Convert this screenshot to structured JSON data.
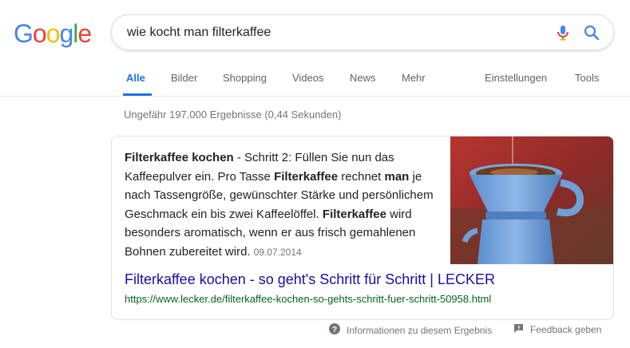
{
  "logo": {
    "letters": [
      "G",
      "o",
      "o",
      "g",
      "l",
      "e"
    ],
    "colors": [
      "#4285F4",
      "#EA4335",
      "#FBBC05",
      "#4285F4",
      "#34A853",
      "#EA4335"
    ]
  },
  "search": {
    "query": "wie kocht man filterkaffee"
  },
  "tabs": {
    "all": "Alle",
    "images": "Bilder",
    "shopping": "Shopping",
    "videos": "Videos",
    "news": "News",
    "more": "Mehr",
    "settings": "Einstellungen",
    "tools": "Tools"
  },
  "stats": "Ungefähr 197.000 Ergebnisse (0,44 Sekunden)",
  "featured": {
    "snippet_parts": [
      {
        "text": "Filterkaffee kochen",
        "bold": true
      },
      {
        "text": " - Schritt 2: Füllen Sie nun das Kaffeepulver ein. Pro Tasse ",
        "bold": false
      },
      {
        "text": "Filterkaffee",
        "bold": true
      },
      {
        "text": " rechnet ",
        "bold": false
      },
      {
        "text": "man",
        "bold": true
      },
      {
        "text": " je nach Tassengröße, gewünschter Stärke und persönlichem Geschmack ein bis zwei Kaffeelöffel. ",
        "bold": false
      },
      {
        "text": "Filterkaffee",
        "bold": true
      },
      {
        "text": " wird besonders aromatisch, wenn er aus frisch gemahlenen Bohnen zubereitet wird.",
        "bold": false
      }
    ],
    "date": "09.07.2014",
    "title_main": "Filterkaffee kochen",
    "title_sep": " - ",
    "title_rest": "so geht's Schritt für Schritt | LECKER",
    "url": "https://www.lecker.de/filterkaffee-kochen-so-gehts-schritt-fuer-schritt-50958.html",
    "image_icon": "coffee-filter-photo"
  },
  "footer": {
    "info": "Informationen zu diesem Ergebnis",
    "feedback": "Feedback geben"
  },
  "colors": {
    "accent": "#1a73e8",
    "link": "#1a0dab",
    "url": "#006621"
  }
}
